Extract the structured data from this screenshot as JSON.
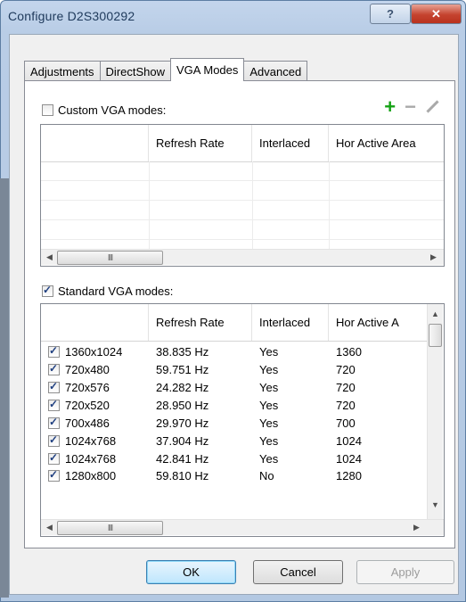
{
  "window": {
    "title": "Configure D2S300292",
    "help_label": "?",
    "close_label": "✕"
  },
  "tabs": [
    {
      "label": "Adjustments"
    },
    {
      "label": "DirectShow"
    },
    {
      "label": "VGA Modes",
      "active": true
    },
    {
      "label": "Advanced"
    }
  ],
  "custom": {
    "checkbox_label": "Custom VGA modes:",
    "checked": false,
    "toolbar": {
      "add_icon": "+",
      "remove_icon": "−"
    },
    "columns": [
      "",
      "Refresh Rate",
      "Interlaced",
      "Hor Active Area"
    ],
    "scroll_left": "◀",
    "scroll_thumb": "III",
    "scroll_right": "▶"
  },
  "standard": {
    "checkbox_label": "Standard VGA modes:",
    "checked": true,
    "columns": [
      "",
      "Refresh Rate",
      "Interlaced",
      "Hor Active A"
    ],
    "rows": [
      {
        "mode": "1360x1024",
        "refresh": "38.835 Hz",
        "interlaced": "Yes",
        "hor": "1360",
        "checked": true
      },
      {
        "mode": "720x480",
        "refresh": "59.751 Hz",
        "interlaced": "Yes",
        "hor": "720",
        "checked": true
      },
      {
        "mode": "720x576",
        "refresh": "24.282 Hz",
        "interlaced": "Yes",
        "hor": "720",
        "checked": true
      },
      {
        "mode": "720x520",
        "refresh": "28.950 Hz",
        "interlaced": "Yes",
        "hor": "720",
        "checked": true
      },
      {
        "mode": "700x486",
        "refresh": "29.970 Hz",
        "interlaced": "Yes",
        "hor": "700",
        "checked": true
      },
      {
        "mode": "1024x768",
        "refresh": "37.904 Hz",
        "interlaced": "Yes",
        "hor": "1024",
        "checked": true
      },
      {
        "mode": "1024x768",
        "refresh": "42.841 Hz",
        "interlaced": "Yes",
        "hor": "1024",
        "checked": true
      },
      {
        "mode": "1280x800",
        "refresh": "59.810 Hz",
        "interlaced": "No",
        "hor": "1280",
        "checked": true
      }
    ],
    "scroll_up": "▲",
    "scroll_down": "▼",
    "scroll_left": "◀",
    "scroll_thumb": "III",
    "scroll_right": "▶"
  },
  "buttons": {
    "ok": "OK",
    "cancel": "Cancel",
    "apply": "Apply"
  }
}
